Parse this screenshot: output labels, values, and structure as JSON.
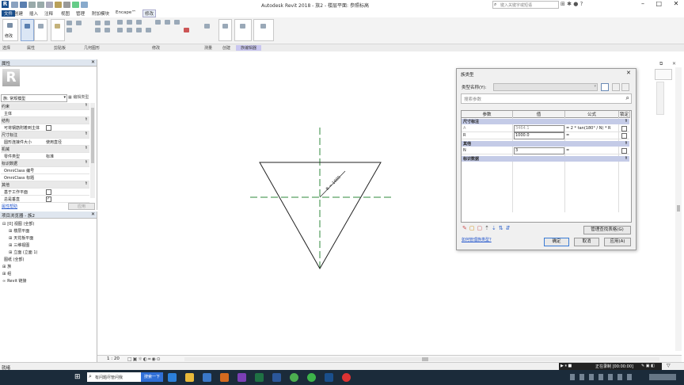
{
  "window": {
    "title": "Autodesk Revit 2018 -    族2 - 楼层平面: 参照标高",
    "search_placeholder": "键入关键字或短语",
    "accent": "#2a6fc9"
  },
  "menu": {
    "tabs": [
      "文件",
      "创建",
      "插入",
      "注释",
      "视图",
      "管理",
      "附加模块",
      "Encape™",
      "修改"
    ],
    "active_index": 8
  },
  "ribbon": {
    "panels": [
      "选择",
      "属性",
      "剪贴板",
      "几何图形",
      "修改",
      "测量",
      "创建",
      "族编辑器"
    ],
    "select_label": "修改",
    "active_panel": "族编辑器"
  },
  "properties": {
    "pane_title": "属性",
    "family_selector": "族: 常规模型",
    "edit_type_label": "编辑类型",
    "rows": [
      {
        "k": "约束",
        "cat": true
      },
      {
        "k": "主体",
        "v": ""
      },
      {
        "k": "结构",
        "cat": true
      },
      {
        "k": "可将钢筋附着到主体",
        "v": "",
        "check": true
      },
      {
        "k": "尺寸标注",
        "cat": true
      },
      {
        "k": "圆形连接件大小",
        "v": "使用直径"
      },
      {
        "k": "机械",
        "cat": true
      },
      {
        "k": "零件类型",
        "v": "标准"
      },
      {
        "k": "标识数据",
        "cat": true
      },
      {
        "k": "OmniClass 编号",
        "v": ""
      },
      {
        "k": "OmniClass 标题",
        "v": ""
      },
      {
        "k": "其他",
        "cat": true
      },
      {
        "k": "基于工作平面",
        "v": "",
        "check": true
      },
      {
        "k": "总是垂直",
        "v": "",
        "check": true,
        "checked": true
      }
    ],
    "help_link": "属性帮助",
    "apply_label": "应用"
  },
  "browser": {
    "pane_title": "项目浏览器 - 族2",
    "items": [
      {
        "label": "[0] 视图 (全部)",
        "indent": 0,
        "tog": "⊟"
      },
      {
        "label": "楼层平面",
        "indent": 1,
        "tog": "⊞"
      },
      {
        "label": "天花板平面",
        "indent": 1,
        "tog": "⊞"
      },
      {
        "label": "三维视图",
        "indent": 1,
        "tog": "⊞"
      },
      {
        "label": "立面 (立面 1)",
        "indent": 1,
        "tog": "⊞"
      },
      {
        "label": "图纸 (全部)",
        "indent": 0,
        "tog": ""
      },
      {
        "label": "族",
        "indent": 0,
        "tog": "⊞"
      },
      {
        "label": "组",
        "indent": 0,
        "tog": "⊞"
      },
      {
        "label": "Revit 链接",
        "indent": 0,
        "tog": "∞"
      }
    ]
  },
  "canvas": {
    "dimension_label": "R = 1000",
    "scale": "1 : 20"
  },
  "dialog": {
    "title": "族类型",
    "type_name_label": "类型名称(Y):",
    "search_placeholder": "搜索参数",
    "columns": [
      "参数",
      "值",
      "公式",
      "锁定"
    ],
    "groups": [
      {
        "name": "尺寸标注",
        "rows": [
          {
            "param": "A",
            "value": "3464.1",
            "formula": "= 2 * tan(180° / N) * R",
            "gray": true
          },
          {
            "param": "R",
            "value": "1000.0",
            "formula": "=",
            "gray": false
          }
        ]
      },
      {
        "name": "其他",
        "rows": [
          {
            "param": "N",
            "value": "3",
            "formula": "=",
            "gray": false
          }
        ]
      },
      {
        "name": "标识数据",
        "rows": []
      }
    ],
    "manage_lookup_label": "管理查找表格(G)",
    "help_link": "如何管理族类型?",
    "ok": "确定",
    "cancel": "取消",
    "apply": "应用(A)"
  },
  "status": {
    "left": "就绪",
    "recording": "正在录制 [00:00:00]"
  },
  "taskbar": {
    "search_text": "有问题尽管问我",
    "search_button": "搜索一下"
  }
}
